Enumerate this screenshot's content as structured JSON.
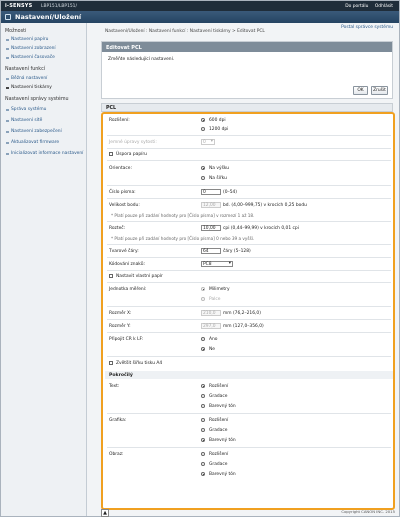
{
  "topbar": {
    "brand": "i-SENSYS",
    "model": "LBP151/LBP151/",
    "portal_link": "Do portálu",
    "logout_link": "Odhlásit"
  },
  "header": {
    "title": "Nastavení/Uložení"
  },
  "sidebar": {
    "group_preferences": "Možnosti",
    "pref_items": [
      "Nastavení papíru",
      "Nastavení zobrazení",
      "Nastavení časovače"
    ],
    "group_functions": "Nastavení funkcí",
    "func_items": [
      "Běžná nastavení",
      "Nastavení tiskárny"
    ],
    "group_mgmt": "Nastavení správy systému",
    "mgmt_items": [
      "Správa systému",
      "Nastavení sítě",
      "Nastavení zabezpečení",
      "Aktualizovat firmware",
      "Inicializovat informace nastavení"
    ]
  },
  "main": {
    "breadcrumb": "Nastavení/Uložení : Nastavení funkcí : Nastavení tiskárny > Editovat PCL",
    "manager_link": "Postal správce systému",
    "panel_title": "Editovat PCL",
    "panel_message": "Změňte následující nastavení.",
    "ok_label": "OK",
    "cancel_label": "Zrušit",
    "section_title": "PCL"
  },
  "form": {
    "resolution_label": "Rozlišení:",
    "res_opt1": "600 dpi",
    "res_opt2": "1200 dpi",
    "pitch_label": "Jemné úpravy sytosti:",
    "pitch_value": "0",
    "economy_label": "Úspora papíru",
    "orientation_label": "Orientace:",
    "orient_opt1": "Na výšku",
    "orient_opt2": "Na šířku",
    "font_number_label": "Číslo písma:",
    "font_number_value": "0",
    "font_number_range": "(0–54)",
    "pointsize_label": "Velikost bodu:",
    "pointsize_value": "12,00",
    "pointsize_range": "bd. (4,00–999,75) v krocích 0,25 bodu",
    "note1": "* Platí pouze při zadání hodnoty pro [Číslo písma] v rozmezí 1 až 18.",
    "pitch2_label": "Rozteč:",
    "pitch2_value": "10,00",
    "pitch2_range": "cpi (0,44–99,99) v krocích 0,01 cpi",
    "note2": "* Platí pouze při zadání hodnoty pro [Číslo písma] 0 nebo 39 a vyšší.",
    "formlines_label": "Tvarové čáry:",
    "formlines_value": "64",
    "formlines_range": "čáry (5–128)",
    "charcode_label": "Kódování znaků:",
    "charcode_value": "PC8",
    "custom_paper_label": "Nastavit vlastní papír",
    "unit_label": "Jednotka měření:",
    "unit_opt1": "Milimetry",
    "unit_opt2": "Palce",
    "xdim_label": "Rozměr X:",
    "xdim_value": "210,0",
    "xdim_range": "mm (76,2–216,0)",
    "ydim_label": "Rozměr Y:",
    "ydim_value": "297,0",
    "ydim_range": "mm (127,0–356,0)",
    "crlf_label": "Připojit CR k LF:",
    "crlf_opt1": "Ano",
    "crlf_opt2": "Ne",
    "a4_label": "Zvětšit šířku tisku A4",
    "advanced_title": "Pokročilý",
    "text_label": "Text:",
    "graphics_label": "Grafika:",
    "image_label": "Obraz:",
    "opt_resolution": "Rozlišení",
    "opt_gradation": "Gradace",
    "opt_colortone": "Barevný tón"
  },
  "footer": {
    "copyright": "Copyright CANON INC. 2015"
  }
}
